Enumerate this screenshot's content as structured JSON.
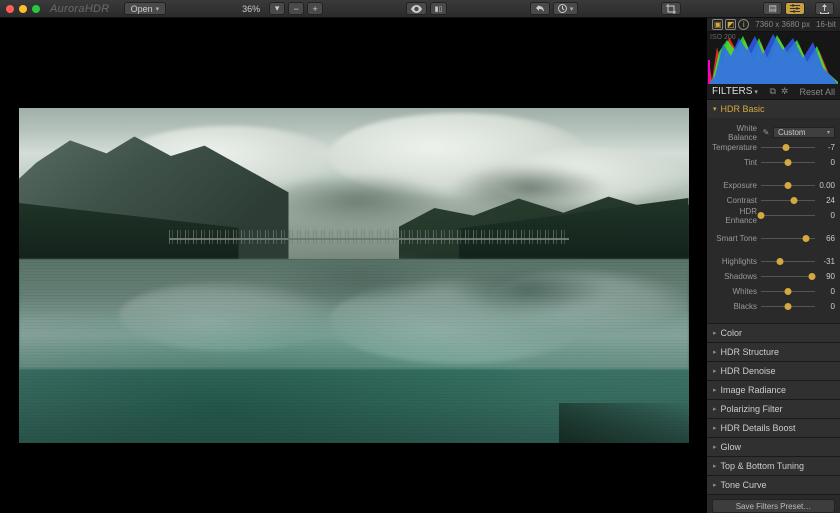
{
  "app": {
    "title": "AuroraHDR"
  },
  "toolbar": {
    "open_label": "Open",
    "zoom_level": "36%",
    "compare_before_after": "AB",
    "crop": "crop",
    "dimensions": "7360 x 3680 px",
    "bit_depth": "16-bit"
  },
  "histogram": {
    "iso_label": "ISO 200"
  },
  "filters": {
    "title": "FILTERS",
    "reset_label": "Reset All",
    "hdr_basic": {
      "title": "HDR Basic",
      "white_balance_label": "White Balance",
      "white_balance_value": "Custom",
      "temperature_label": "Temperature",
      "temperature_value": "-7",
      "tint_label": "Tint",
      "tint_value": "0",
      "exposure_label": "Exposure",
      "exposure_value": "0.00",
      "contrast_label": "Contrast",
      "contrast_value": "24",
      "hdr_enhance_label": "HDR Enhance",
      "hdr_enhance_value": "0",
      "smart_tone_label": "Smart Tone",
      "smart_tone_value": "66",
      "highlights_label": "Highlights",
      "highlights_value": "-31",
      "shadows_label": "Shadows",
      "shadows_value": "90",
      "whites_label": "Whites",
      "whites_value": "0",
      "blacks_label": "Blacks",
      "blacks_value": "0"
    },
    "collapsed": {
      "color": "Color",
      "hdr_structure": "HDR Structure",
      "hdr_denoise": "HDR Denoise",
      "image_radiance": "Image Radiance",
      "polarizing_filter": "Polarizing Filter",
      "hdr_details_boost": "HDR Details Boost",
      "glow": "Glow",
      "top_bottom_tuning": "Top & Bottom Tuning",
      "tone_curve": "Tone Curve"
    },
    "save_preset_label": "Save Filters Preset"
  },
  "slider_positions": {
    "temperature": 47,
    "tint": 50,
    "exposure": 50,
    "contrast": 62,
    "hdr_enhance": 0,
    "smart_tone": 83,
    "highlights": 35,
    "shadows": 95,
    "whites": 50,
    "blacks": 50
  }
}
